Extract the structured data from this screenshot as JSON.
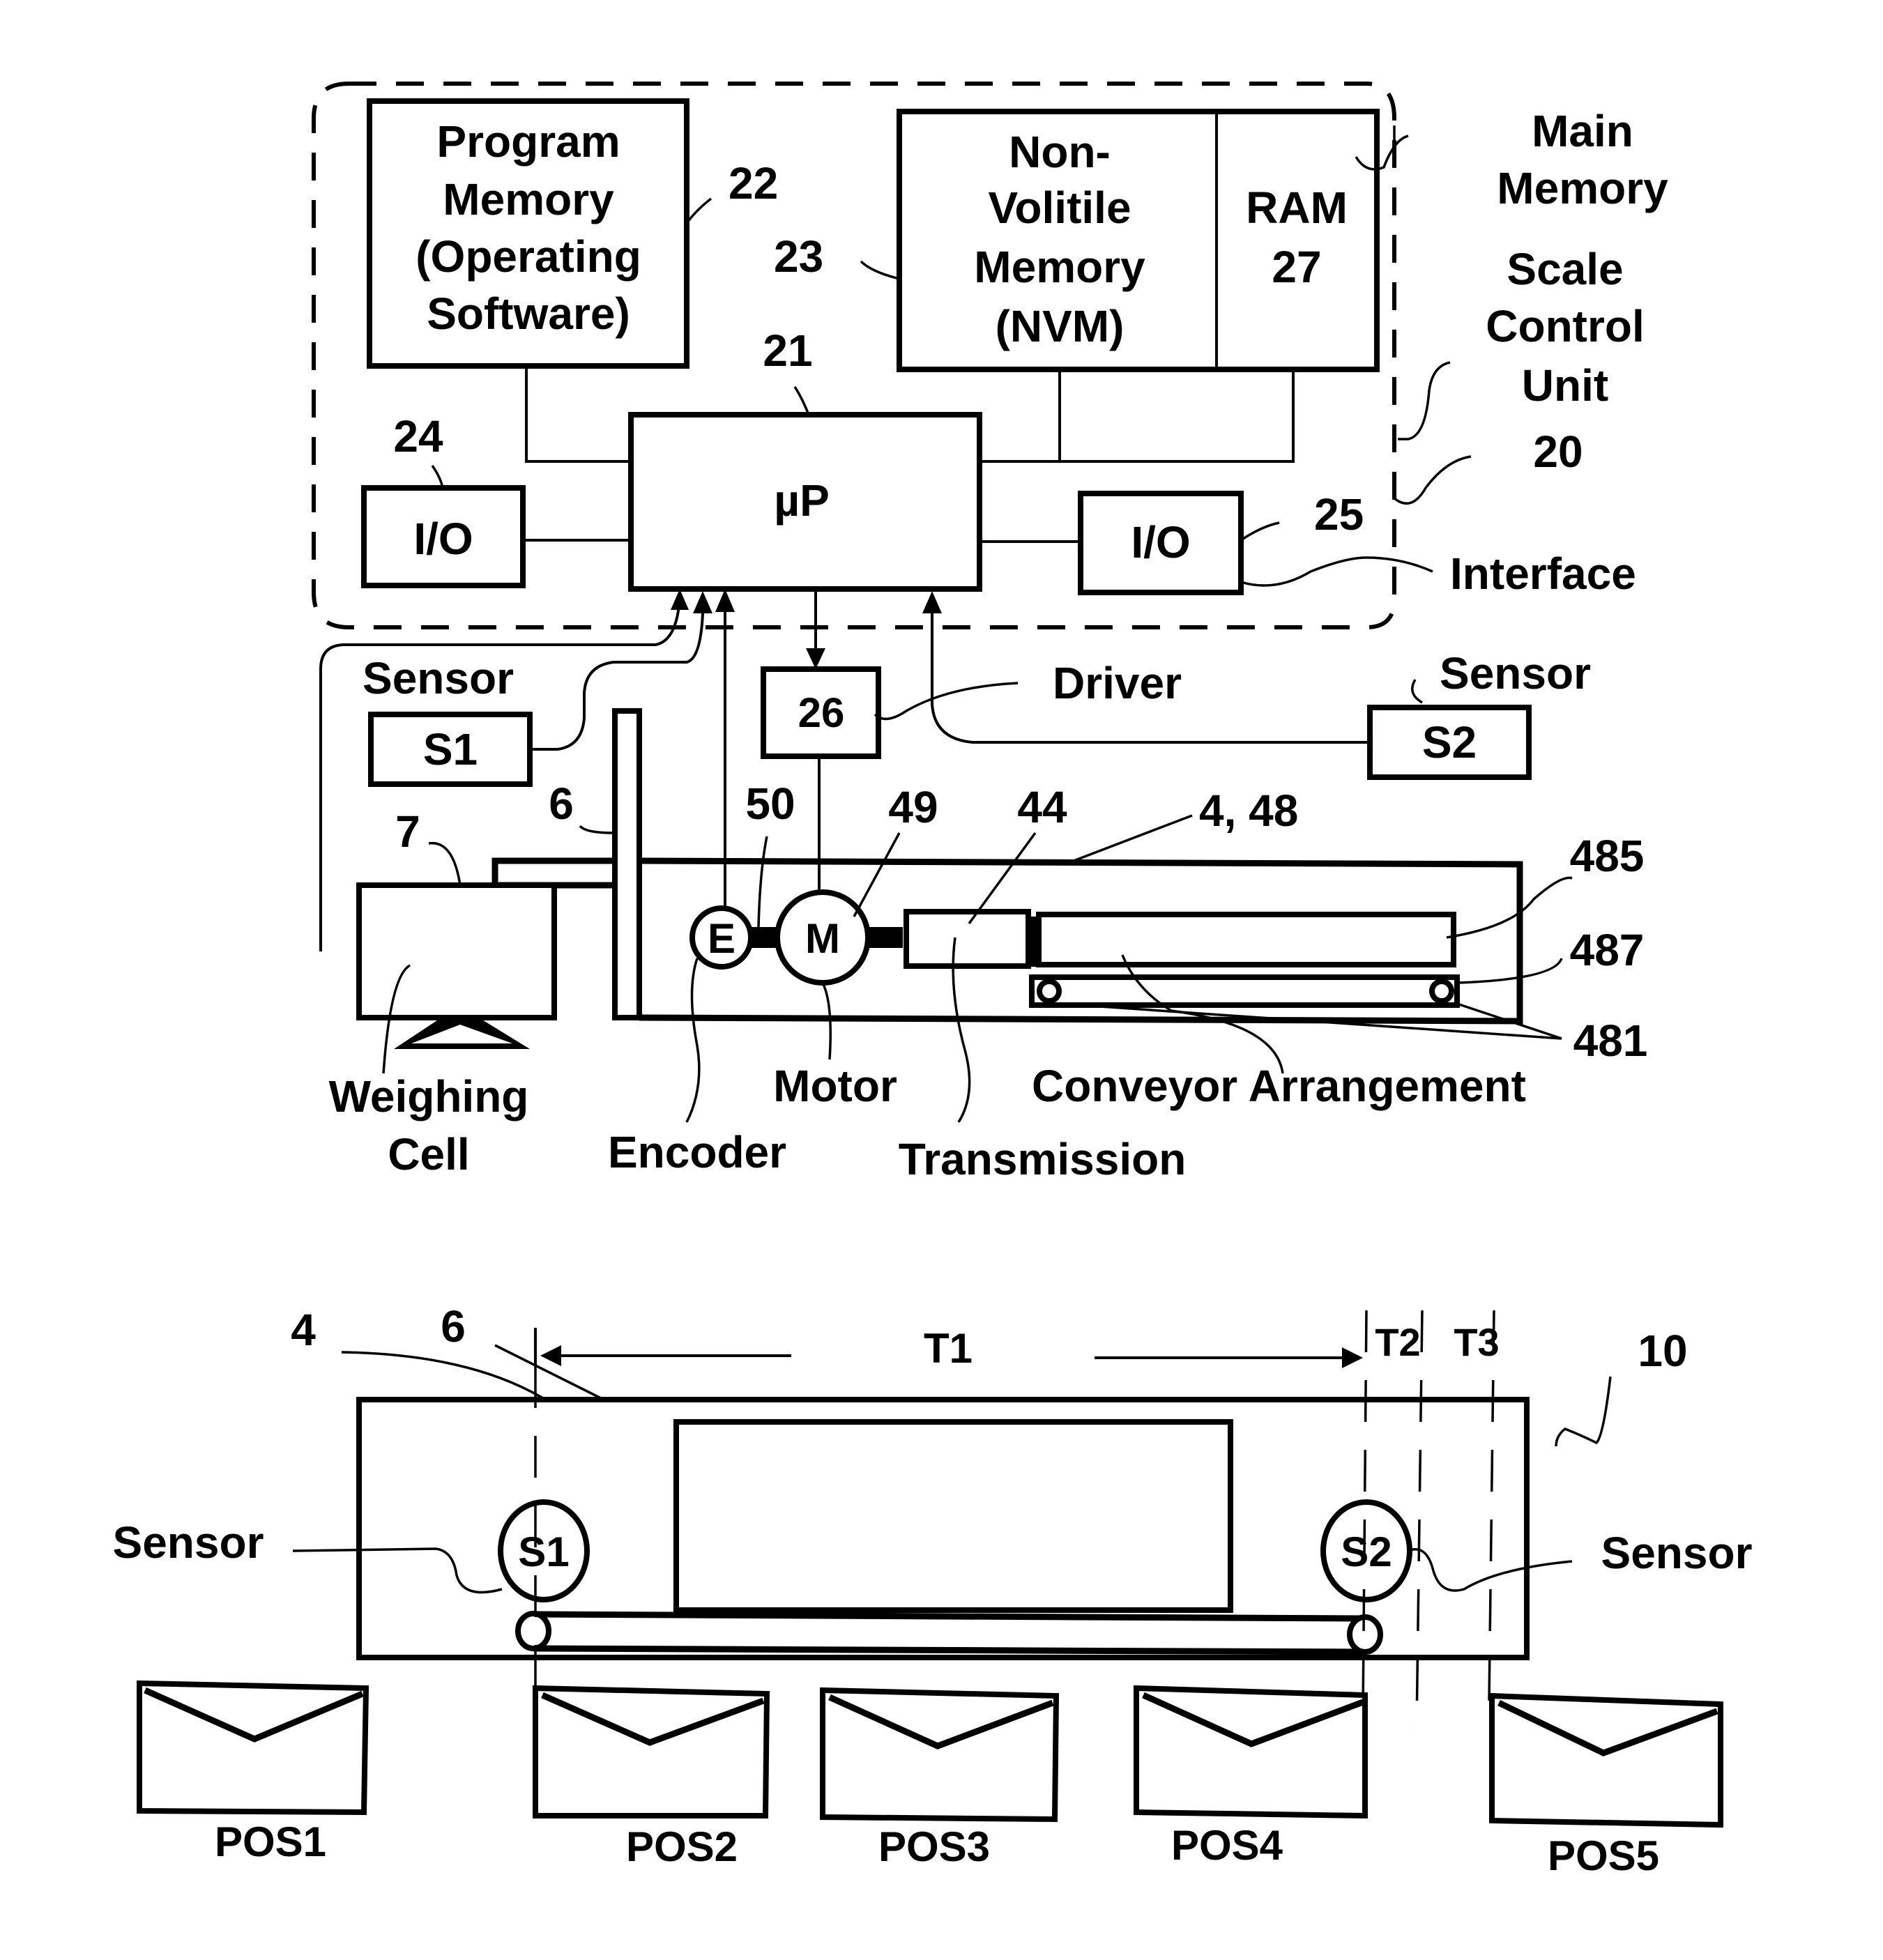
{
  "figure_top": {
    "enclosure": {
      "label_lines": [
        "Scale",
        "Control",
        "Unit"
      ],
      "ref": "20"
    },
    "program_memory": {
      "lines": [
        "Program",
        "Memory",
        "(Operating",
        "Software)"
      ],
      "ref": "22"
    },
    "nvm": {
      "lines": [
        "Non-",
        "Volitile",
        "Memory",
        "(NVM)"
      ],
      "ref": "23"
    },
    "ram": {
      "lines": [
        "RAM",
        "27"
      ]
    },
    "main_memory": {
      "lines": [
        "Main",
        "Memory"
      ]
    },
    "microprocessor": {
      "label": "µP",
      "ref": "21"
    },
    "io_left": {
      "label": "I/O",
      "ref": "24"
    },
    "io_right": {
      "label": "I/O",
      "ref": "25",
      "name": "Interface"
    },
    "driver": {
      "label": "26",
      "name": "Driver"
    },
    "sensor_s1": {
      "label": "S1",
      "name": "Sensor"
    },
    "sensor_s2": {
      "label": "S2",
      "name": "Sensor"
    },
    "weighing_cell": {
      "ref": "7",
      "lines": [
        "Weighing",
        "Cell"
      ]
    },
    "plate": {
      "ref": "6"
    },
    "encoder": {
      "label": "E",
      "ref": "50",
      "name": "Encoder"
    },
    "motor": {
      "label": "M",
      "ref": "49",
      "name": "Motor"
    },
    "transmission": {
      "ref": "44",
      "name": "Transmission"
    },
    "housing": {
      "ref": "4, 48"
    },
    "conveyor": {
      "name": "Conveyor Arrangement",
      "refs": [
        "485",
        "487",
        "481"
      ]
    }
  },
  "figure_bottom": {
    "refs": {
      "housing": "4",
      "plate": "6",
      "device": "10"
    },
    "intervals": [
      "T1",
      "T2",
      "T3"
    ],
    "sensor_s1": {
      "label": "S1",
      "name": "Sensor"
    },
    "sensor_s2": {
      "label": "S2",
      "name": "Sensor"
    },
    "positions": [
      "POS1",
      "POS2",
      "POS3",
      "POS4",
      "POS5"
    ]
  }
}
